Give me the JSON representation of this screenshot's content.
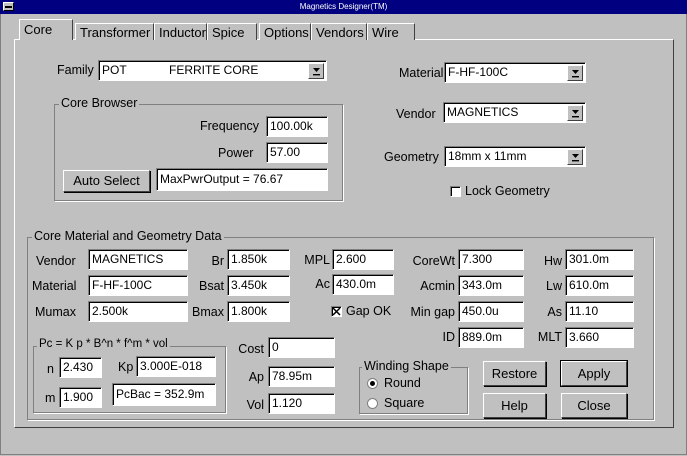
{
  "window": {
    "title": "Magnetics Designer(TM)"
  },
  "tabs": [
    "Core",
    "Transformer",
    "Inductor",
    "Spice",
    "Options",
    "Vendors",
    "Wire"
  ],
  "family": {
    "label": "Family",
    "value1": "POT",
    "value2": "FERRITE CORE"
  },
  "material_select": {
    "label": "Material",
    "value": "F-HF-100C"
  },
  "vendor_select": {
    "label": "Vendor",
    "value": "MAGNETICS"
  },
  "geometry_select": {
    "label": "Geometry",
    "value": "18mm x 11mm"
  },
  "lock_geometry": {
    "label": "Lock Geometry",
    "checked": false
  },
  "core_browser": {
    "title": "Core Browser",
    "frequency_label": "Frequency",
    "frequency": "100.00k",
    "power_label": "Power",
    "power": "57.00",
    "auto_select": "Auto Select",
    "result": "MaxPwrOutput = 76.67"
  },
  "cmgd": {
    "title": "Core Material and Geometry Data",
    "vendor_label": "Vendor",
    "vendor": "MAGNETICS",
    "material_label": "Material",
    "material": "F-HF-100C",
    "mumax_label": "Mumax",
    "mumax": "2.500k",
    "br_label": "Br",
    "br": "1.850k",
    "bsat_label": "Bsat",
    "bsat": "3.450k",
    "bmax_label": "Bmax",
    "bmax": "1.800k",
    "mpl_label": "MPL",
    "mpl": "2.600",
    "ac_label": "Ac",
    "ac": "430.0m",
    "gapok_label": "Gap OK",
    "gapok_checked": true,
    "corewt_label": "CoreWt",
    "corewt": "7.300",
    "acmin_label": "Acmin",
    "acmin": "343.0m",
    "mingap_label": "Min gap",
    "mingap": "450.0u",
    "id_label": "ID",
    "id": "889.0m",
    "hw_label": "Hw",
    "hw": "301.0m",
    "lw_label": "Lw",
    "lw": "610.0m",
    "as_label": "As",
    "as": "11.10",
    "mlt_label": "MLT",
    "mlt": "3.660"
  },
  "pc": {
    "title": "Pc = K p * B^n * f^m * vol",
    "n_label": "n",
    "n": "2.430",
    "kp_label": "Kp",
    "kp": "3.000E-018",
    "m_label": "m",
    "m": "1.900",
    "pcbac": "PcBac = 352.9m"
  },
  "cost": {
    "label": "Cost",
    "value": "0"
  },
  "ap": {
    "label": "Ap",
    "value": "78.95m"
  },
  "vol": {
    "label": "Vol",
    "value": "1.120"
  },
  "winding": {
    "title": "Winding Shape",
    "round": "Round",
    "square": "Square",
    "selected": "Round"
  },
  "buttons": {
    "restore": "Restore",
    "apply": "Apply",
    "help": "Help",
    "close": "Close"
  }
}
